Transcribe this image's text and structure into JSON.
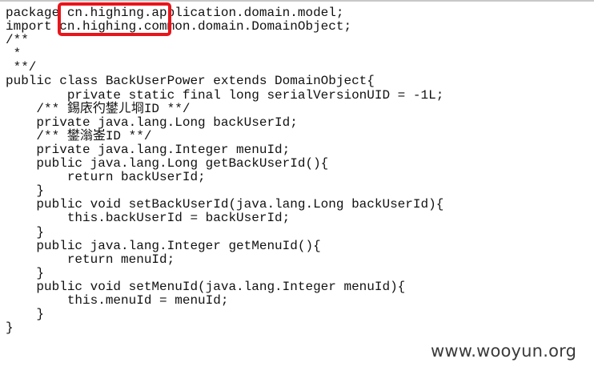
{
  "code_lines": [
    "package cn.highing.application.domain.model;",
    "import cn.highing.common.domain.DomainObject;",
    "/**",
    " *",
    " **/",
    "public class BackUserPower extends DomainObject{",
    "        private static final long serialVersionUID = -1L;",
    "    /** 錫庡彴鐢ㄦ埛ID **/",
    "    private java.lang.Long backUserId;",
    "    /** 鐢滃崟ID **/",
    "    private java.lang.Integer menuId;",
    "    public java.lang.Long getBackUserId(){",
    "        return backUserId;",
    "    }",
    "    public void setBackUserId(java.lang.Long backUserId){",
    "        this.backUserId = backUserId;",
    "    }",
    "    public java.lang.Integer getMenuId(){",
    "        return menuId;",
    "    }",
    "    public void setMenuId(java.lang.Integer menuId){",
    "        this.menuId = menuId;",
    "    }",
    "}"
  ],
  "highlight_color": "#e8151b",
  "watermark": "www.wooyun.org"
}
